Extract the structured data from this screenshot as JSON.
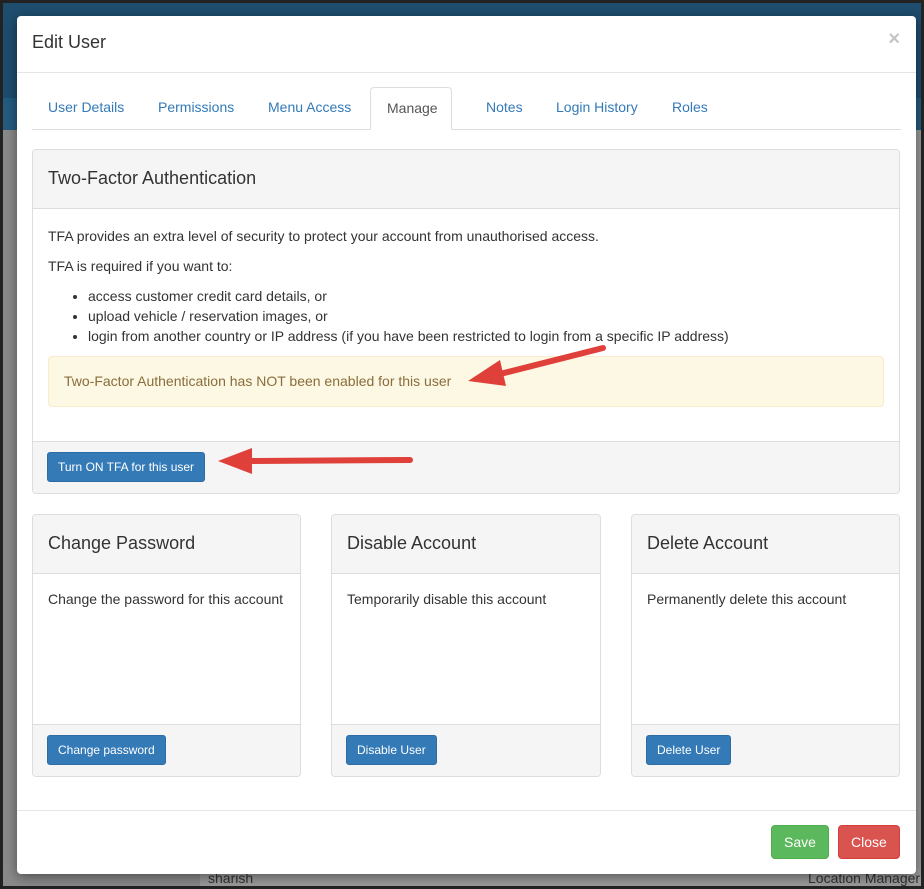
{
  "modal": {
    "title": "Edit User",
    "close_symbol": "×",
    "tabs": [
      {
        "label": "User Details"
      },
      {
        "label": "Permissions"
      },
      {
        "label": "Menu Access"
      },
      {
        "label": "Manage",
        "active": true
      },
      {
        "label": "Notes"
      },
      {
        "label": "Login History"
      },
      {
        "label": "Roles"
      }
    ]
  },
  "tfa": {
    "heading": "Two-Factor Authentication",
    "intro": "TFA provides an extra level of security to protect your account from unauthorised access.",
    "required_text": "TFA is required if you want to:",
    "items": [
      "access customer credit card details, or",
      "upload vehicle / reservation images, or",
      "login from another country or IP address (if you have been restricted to login from a specific IP address)"
    ],
    "alert": "Two-Factor Authentication has NOT been enabled for this user",
    "button": "Turn ON TFA for this user"
  },
  "cards": [
    {
      "heading": "Change Password",
      "body": "Change the password for this account",
      "button": "Change password"
    },
    {
      "heading": "Disable Account",
      "body": "Temporarily disable this account",
      "button": "Disable User"
    },
    {
      "heading": "Delete Account",
      "body": "Permanently delete this account",
      "button": "Delete User"
    }
  ],
  "footer": {
    "save": "Save",
    "close": "Close"
  },
  "background": {
    "bottom_left_text": "sharish",
    "bottom_right_text": "Location Manager"
  },
  "colors": {
    "primary": "#337ab7",
    "success": "#5cb85c",
    "danger": "#d9534f",
    "annotation_arrow": "#e0403a",
    "alert_bg": "#fcf8e3"
  }
}
